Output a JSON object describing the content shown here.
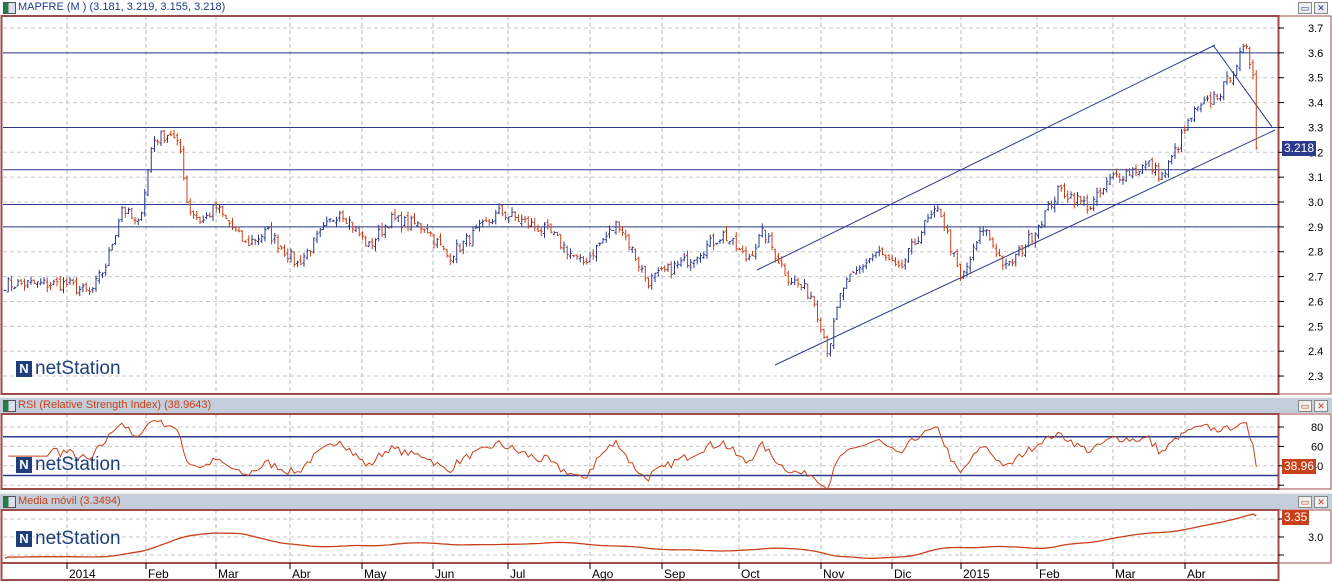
{
  "main": {
    "title": "MAPFRE (M ) (3.181, 3.219, 3.155, 3.218)",
    "last_tag": "3.218",
    "ticks": [
      "3.7",
      "3.6",
      "3.5",
      "3.4",
      "3.3",
      "3.2",
      "3.1",
      "3.0",
      "2.9",
      "2.8",
      "2.7",
      "2.6",
      "2.5",
      "2.4",
      "2.3"
    ]
  },
  "rsi": {
    "title": "RSI (Relative Strength Index) (38.9643)",
    "last_tag": "38.96",
    "ticks": [
      "80",
      "60",
      "40"
    ]
  },
  "ma": {
    "title": "Media móvil (3.3494)",
    "last_tag": "3.35",
    "ticks": [
      "3.0"
    ]
  },
  "logo": "netStation",
  "buttons": {
    "minimize": "▭",
    "close": "✕"
  },
  "colors": {
    "up": "#2b3a8c",
    "down": "#c8401a",
    "line": "#c8401a",
    "frame": "#9c4a4a"
  },
  "chart_data": {
    "type": "line",
    "title": "MAPFRE (M )",
    "x_labels": [
      "2014",
      "Feb",
      "Mar",
      "Abr",
      "May",
      "Jun",
      "Jul",
      "Ago",
      "Sep",
      "Oct",
      "Nov",
      "Dic",
      "2015",
      "Feb",
      "Mar",
      "Abr"
    ],
    "ylim": [
      2.3,
      3.7
    ],
    "price_path": [
      [
        0,
        2.67
      ],
      [
        0.3,
        2.63
      ],
      [
        0.5,
        2.75
      ],
      [
        0.7,
        2.98
      ],
      [
        0.9,
        2.9
      ],
      [
        1.1,
        3.25
      ],
      [
        1.35,
        3.28
      ],
      [
        1.5,
        3.2
      ],
      [
        1.6,
        2.98
      ],
      [
        1.8,
        2.92
      ],
      [
        2.0,
        2.98
      ],
      [
        2.4,
        2.83
      ],
      [
        2.7,
        2.88
      ],
      [
        3.1,
        2.75
      ],
      [
        3.7,
        2.97
      ],
      [
        4.1,
        2.82
      ],
      [
        4.4,
        2.93
      ],
      [
        4.9,
        2.9
      ],
      [
        5.2,
        2.78
      ],
      [
        5.9,
        2.96
      ],
      [
        6.5,
        2.88
      ],
      [
        6.9,
        2.75
      ],
      [
        7.4,
        2.92
      ],
      [
        7.8,
        2.68
      ],
      [
        8.3,
        2.76
      ],
      [
        8.8,
        2.87
      ],
      [
        9.1,
        2.77
      ],
      [
        9.3,
        2.88
      ],
      [
        9.6,
        2.7
      ],
      [
        9.9,
        2.62
      ],
      [
        10.1,
        2.4
      ],
      [
        10.3,
        2.65
      ],
      [
        10.6,
        2.75
      ],
      [
        10.8,
        2.8
      ],
      [
        11.1,
        2.72
      ],
      [
        11.5,
        2.92
      ],
      [
        11.7,
        2.97
      ],
      [
        12.0,
        2.68
      ],
      [
        12.3,
        2.9
      ],
      [
        12.6,
        2.73
      ],
      [
        12.9,
        2.85
      ],
      [
        13.3,
        3.05
      ],
      [
        13.7,
        2.98
      ],
      [
        14.0,
        3.1
      ],
      [
        14.5,
        3.15
      ],
      [
        14.7,
        3.1
      ],
      [
        15.1,
        3.35
      ],
      [
        15.5,
        3.45
      ],
      [
        15.8,
        3.62
      ],
      [
        16.0,
        3.45
      ],
      [
        16.2,
        3.35
      ],
      [
        16.35,
        3.15
      ],
      [
        16.45,
        3.2
      ]
    ],
    "last": {
      "open": 3.181,
      "high": 3.219,
      "low": 3.155,
      "close": 3.218
    },
    "hlines": [
      3.6,
      3.3,
      3.13,
      2.99,
      2.9
    ],
    "rsi_last": 38.9643,
    "rsi_levels": [
      70,
      30
    ],
    "ma_last": 3.3494
  }
}
